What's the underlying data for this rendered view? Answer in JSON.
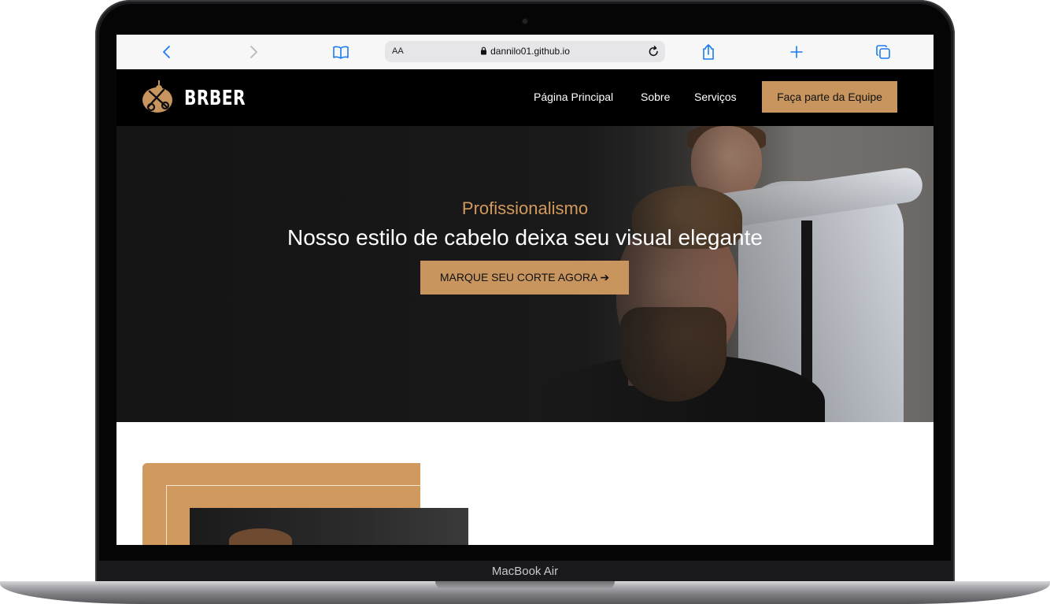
{
  "device": {
    "label": "MacBook Air"
  },
  "browser": {
    "back_icon": "chevron-left-icon",
    "forward_icon": "chevron-right-icon",
    "bookmarks_icon": "book-icon",
    "text_size_label": "AA",
    "url": "dannilo01.github.io",
    "reload_icon": "reload-icon",
    "share_icon": "share-icon",
    "new_tab_icon": "plus-icon",
    "tabs_icon": "tabs-icon"
  },
  "site": {
    "logo_text": "BRBER",
    "nav": {
      "items": [
        {
          "label": "Página Principal"
        },
        {
          "label": "Sobre"
        },
        {
          "label": "Serviços"
        }
      ],
      "cta_label": "Faça parte da Equipe"
    },
    "hero": {
      "subtitle": "Profissionalismo",
      "title": "Nosso estilo de cabelo deixa seu visual elegante",
      "button_label": "MARQUE SEU CORTE AGORA ➔"
    }
  },
  "colors": {
    "accent": "#c8955e",
    "subtitle": "#d39a5c",
    "nav_bg": "#000000",
    "browser_icon": "#1a7cf0"
  }
}
